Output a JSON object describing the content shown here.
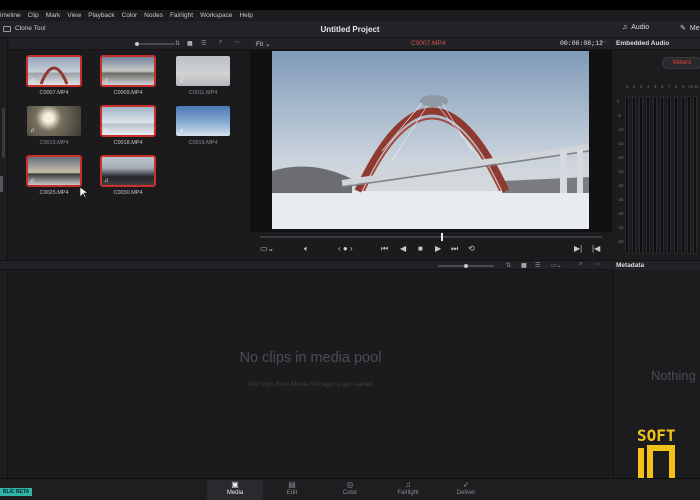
{
  "menubar": {
    "items": [
      "imeline",
      "Clip",
      "Mark",
      "View",
      "Playback",
      "Color",
      "Nodes",
      "Fairlight",
      "Workspace",
      "Help"
    ]
  },
  "titlebar": {
    "clone_tool": "Clone Tool",
    "project_title": "Untitled Project",
    "audio_tab": "Audio",
    "metadata_tab": "Me"
  },
  "viewer": {
    "zoom": "Fit",
    "clip_name": "C0007.MP4",
    "timecode": "00:00:08;12"
  },
  "media_pool": {
    "clips": [
      {
        "name": "C0007.MP4",
        "selected": true
      },
      {
        "name": "C0009.MP4",
        "selected": true
      },
      {
        "name": "C0011.MP4",
        "selected": false
      },
      {
        "name": "C0015.MP4",
        "selected": false
      },
      {
        "name": "C0018.MP4",
        "selected": true
      },
      {
        "name": "C0019.MP4",
        "selected": false
      },
      {
        "name": "C0025.MP4",
        "selected": true
      },
      {
        "name": "C0030.MP4",
        "selected": true
      }
    ],
    "empty_title": "No clips in media pool",
    "empty_subtitle": "Add clips from Media Storage to get started"
  },
  "audio_panel": {
    "title": "Embedded Audio",
    "meters_button": "Meters",
    "scale": [
      "0",
      "-5",
      "-10",
      "-15",
      "-20",
      "-25",
      "-30",
      "-35",
      "-40",
      "-45",
      "-50"
    ],
    "channels": [
      "1",
      "2",
      "3",
      "4",
      "5",
      "6",
      "7",
      "8",
      "9",
      "10",
      "11"
    ]
  },
  "metadata_panel": {
    "title": "Metadata",
    "empty_text": "Nothing"
  },
  "badge": {
    "public_beta": "BLIC BETA"
  },
  "logo": {
    "line1": "SOFT",
    "line2": "10"
  },
  "pages": [
    {
      "label": "Media",
      "icon": "▣",
      "active": true
    },
    {
      "label": "Edit",
      "icon": "▤",
      "active": false
    },
    {
      "label": "Color",
      "icon": "◎",
      "active": false
    },
    {
      "label": "Fairlight",
      "icon": "♫",
      "active": false
    },
    {
      "label": "Deliver",
      "icon": "➶",
      "active": false
    }
  ],
  "colors": {
    "accent_red": "#c9302c",
    "timecode_red": "#d9534f",
    "beta_teal": "#2fb3a7",
    "logo_yellow": "#f2c21a"
  }
}
